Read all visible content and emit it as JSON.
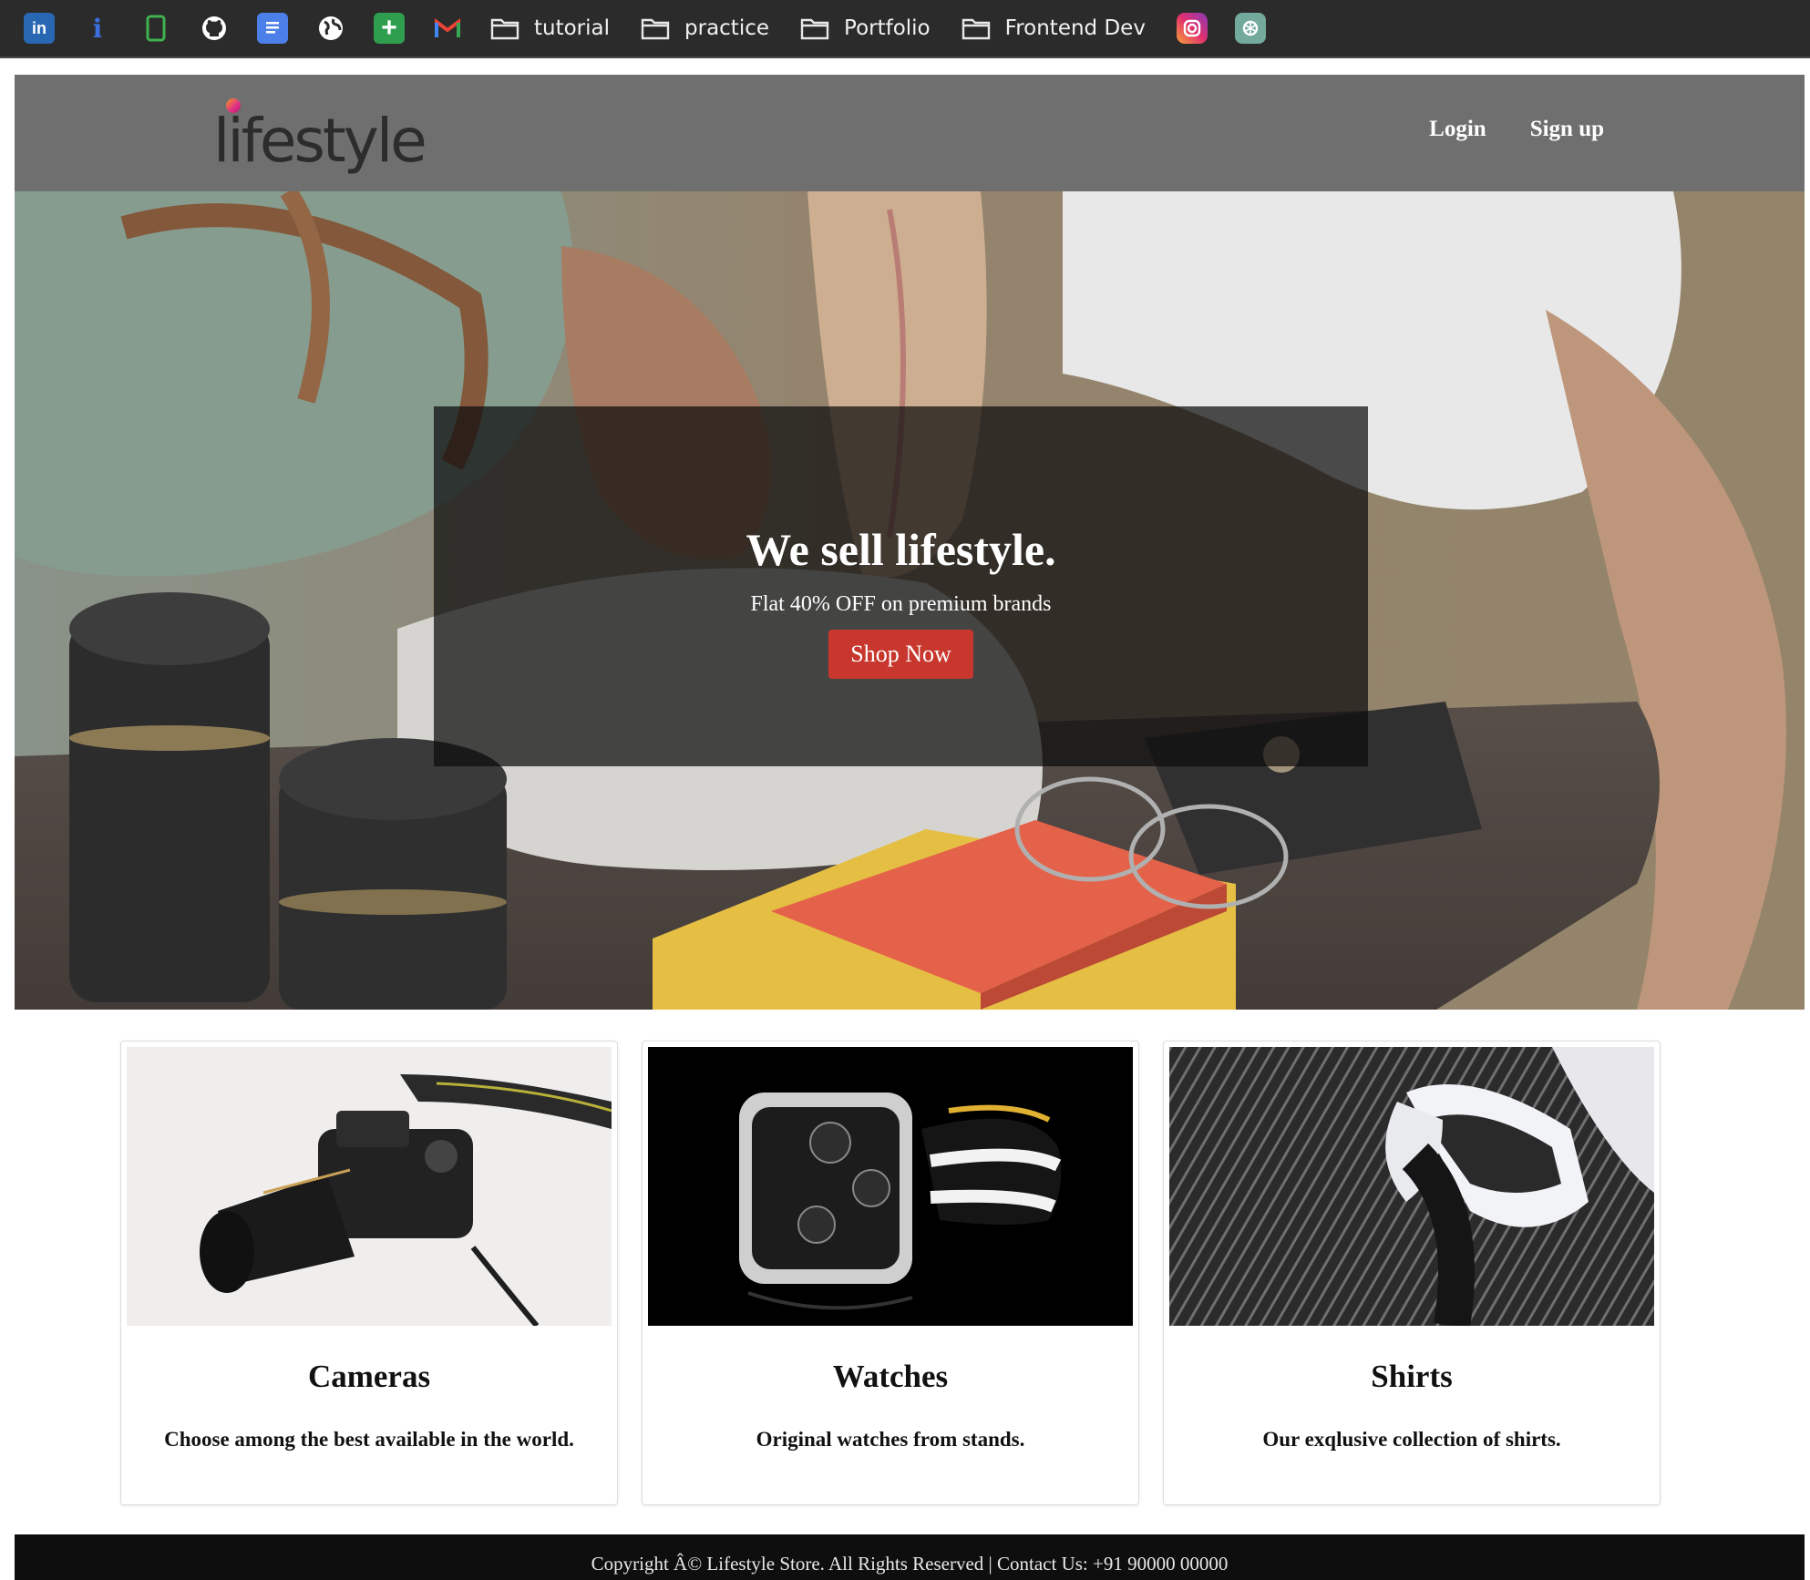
{
  "bookmarks": {
    "icons": [
      {
        "name": "linkedin-icon",
        "glyph": "in",
        "color": "#2867b2"
      },
      {
        "name": "info-icon",
        "glyph": "i",
        "color": "#3b6fe0"
      },
      {
        "name": "tablet-icon",
        "glyph": "",
        "color": "#3fb24f"
      },
      {
        "name": "github-icon",
        "glyph": "",
        "color": "#ffffff"
      },
      {
        "name": "docs-icon",
        "glyph": "",
        "color": "#4c7fe8"
      },
      {
        "name": "globe-icon",
        "glyph": "",
        "color": "#ffffff"
      },
      {
        "name": "sheets-plus-icon",
        "glyph": "+",
        "color": "#2f9e4f"
      },
      {
        "name": "gmail-icon",
        "glyph": "M",
        "color": "#ea4335"
      }
    ],
    "folders": [
      "tutorial",
      "practice",
      "Portfolio",
      "Frontend Dev"
    ],
    "trailing_icons": [
      {
        "name": "instagram-icon",
        "color": "#e1306c"
      },
      {
        "name": "chatgpt-icon",
        "color": "#74aa9c"
      }
    ]
  },
  "navbar": {
    "logo": "lifestyle",
    "links": {
      "login": "Login",
      "signup": "Sign up"
    },
    "background": "#6f6f6f"
  },
  "hero": {
    "title": "We sell lifestyle.",
    "subtitle": "Flat 40% OFF on premium brands",
    "button": "Shop Now",
    "button_color": "#c8372d"
  },
  "cards": [
    {
      "title": "Cameras",
      "text": "Choose among the best available in the world.",
      "image": "camera"
    },
    {
      "title": "Watches",
      "text": "Original watches from stands.",
      "image": "watch"
    },
    {
      "title": "Shirts",
      "text": "Our exqlusive collection of shirts.",
      "image": "shirt"
    }
  ],
  "footer": {
    "text": "Copyright Â© Lifestyle Store. All Rights Reserved | Contact Us: +91 90000 00000"
  }
}
